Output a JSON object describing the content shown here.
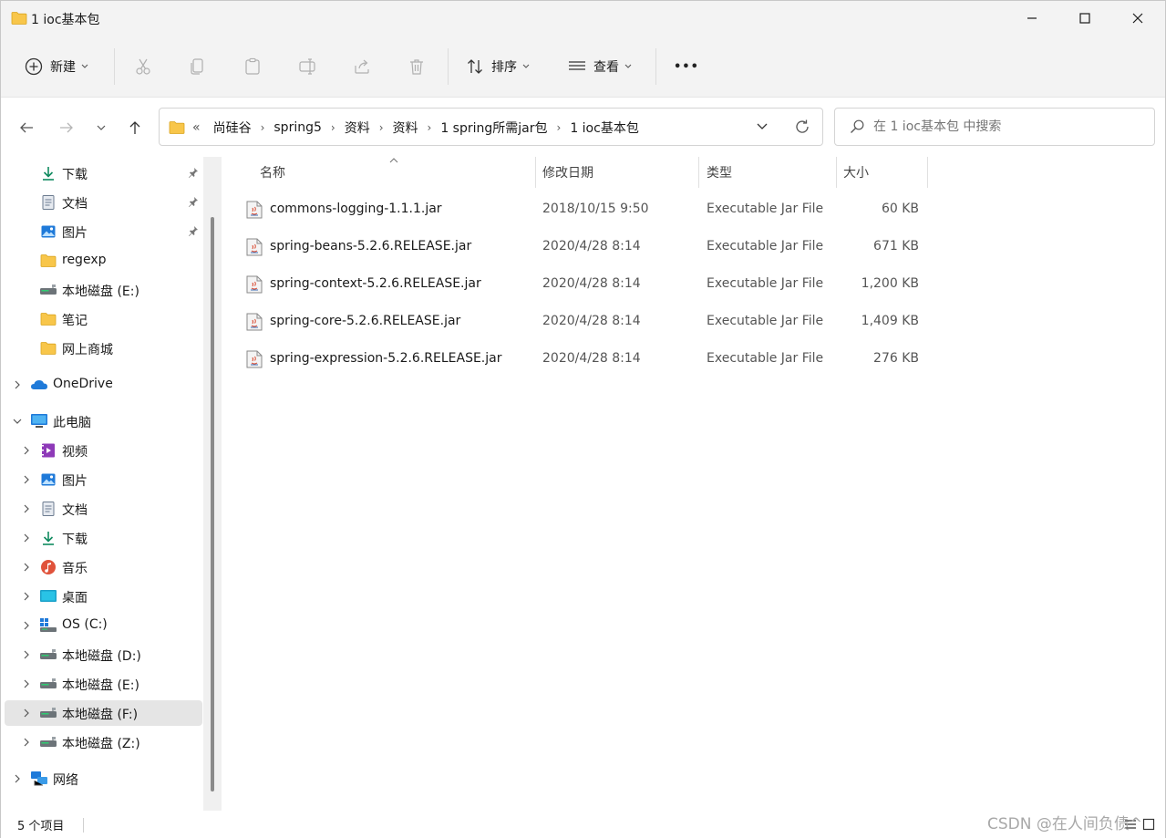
{
  "window": {
    "title": "1 ioc基本包"
  },
  "commandbar": {
    "new_label": "新建",
    "sort_label": "排序",
    "view_label": "查看",
    "more_label": "•••"
  },
  "address": {
    "overflow": "«",
    "crumbs": [
      "尚硅谷",
      "spring5",
      "资料",
      "资料",
      "1 spring所需jar包",
      "1 ioc基本包"
    ],
    "search_placeholder": "在 1 ioc基本包 中搜索"
  },
  "navpane": {
    "quick_access": [
      {
        "label": "下载",
        "icon": "download-icon",
        "pinned": true
      },
      {
        "label": "文档",
        "icon": "document-icon",
        "pinned": true
      },
      {
        "label": "图片",
        "icon": "pictures-icon",
        "pinned": true
      },
      {
        "label": "regexp",
        "icon": "folder-icon",
        "pinned": false
      },
      {
        "label": "本地磁盘 (E:)",
        "icon": "drive-icon",
        "pinned": false
      },
      {
        "label": "笔记",
        "icon": "folder-icon",
        "pinned": false
      },
      {
        "label": "网上商城",
        "icon": "folder-icon",
        "pinned": false
      }
    ],
    "onedrive": "OneDrive",
    "this_pc": "此电脑",
    "pc_items": [
      {
        "label": "视频",
        "icon": "videos-icon"
      },
      {
        "label": "图片",
        "icon": "pictures-icon"
      },
      {
        "label": "文档",
        "icon": "document-icon"
      },
      {
        "label": "下载",
        "icon": "download-icon"
      },
      {
        "label": "音乐",
        "icon": "music-icon"
      },
      {
        "label": "桌面",
        "icon": "desktop-icon"
      },
      {
        "label": "OS (C:)",
        "icon": "os-drive-icon"
      },
      {
        "label": "本地磁盘 (D:)",
        "icon": "drive-icon"
      },
      {
        "label": "本地磁盘 (E:)",
        "icon": "drive-icon"
      },
      {
        "label": "本地磁盘 (F:)",
        "icon": "drive-icon",
        "selected": true
      },
      {
        "label": "本地磁盘 (Z:)",
        "icon": "drive-icon"
      }
    ],
    "network": "网络"
  },
  "columns": {
    "name": "名称",
    "date": "修改日期",
    "type": "类型",
    "size": "大小"
  },
  "files": [
    {
      "name": "commons-logging-1.1.1.jar",
      "date": "2018/10/15 9:50",
      "type": "Executable Jar File",
      "size": "60 KB"
    },
    {
      "name": "spring-beans-5.2.6.RELEASE.jar",
      "date": "2020/4/28 8:14",
      "type": "Executable Jar File",
      "size": "671 KB"
    },
    {
      "name": "spring-context-5.2.6.RELEASE.jar",
      "date": "2020/4/28 8:14",
      "type": "Executable Jar File",
      "size": "1,200 KB"
    },
    {
      "name": "spring-core-5.2.6.RELEASE.jar",
      "date": "2020/4/28 8:14",
      "type": "Executable Jar File",
      "size": "1,409 KB"
    },
    {
      "name": "spring-expression-5.2.6.RELEASE.jar",
      "date": "2020/4/28 8:14",
      "type": "Executable Jar File",
      "size": "276 KB"
    }
  ],
  "status": {
    "item_count": "5 个项目"
  },
  "watermark": "CSDN @在人间负债^",
  "colors": {
    "folder": "#f8c64a",
    "accent": "#0067c0",
    "selected_bg": "#e5e5e5"
  }
}
